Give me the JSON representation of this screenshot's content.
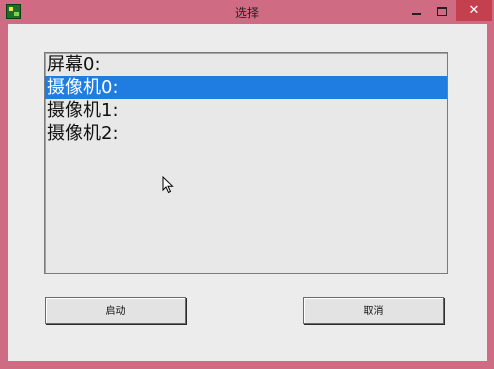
{
  "window": {
    "title": "选择",
    "icon": "app-icon",
    "controls": {
      "minimize": "minimize-icon",
      "maximize": "maximize-icon",
      "close": "✕"
    },
    "accent_color": "#cf6b82"
  },
  "list": {
    "items": [
      {
        "label": "屏幕0:",
        "selected": false
      },
      {
        "label": "摄像机0:",
        "selected": true
      },
      {
        "label": "摄像机1:",
        "selected": false
      },
      {
        "label": "摄像机2:",
        "selected": false
      }
    ],
    "selection_color": "#1f7ce0"
  },
  "buttons": {
    "start_label": "启动",
    "cancel_label": "取消"
  }
}
